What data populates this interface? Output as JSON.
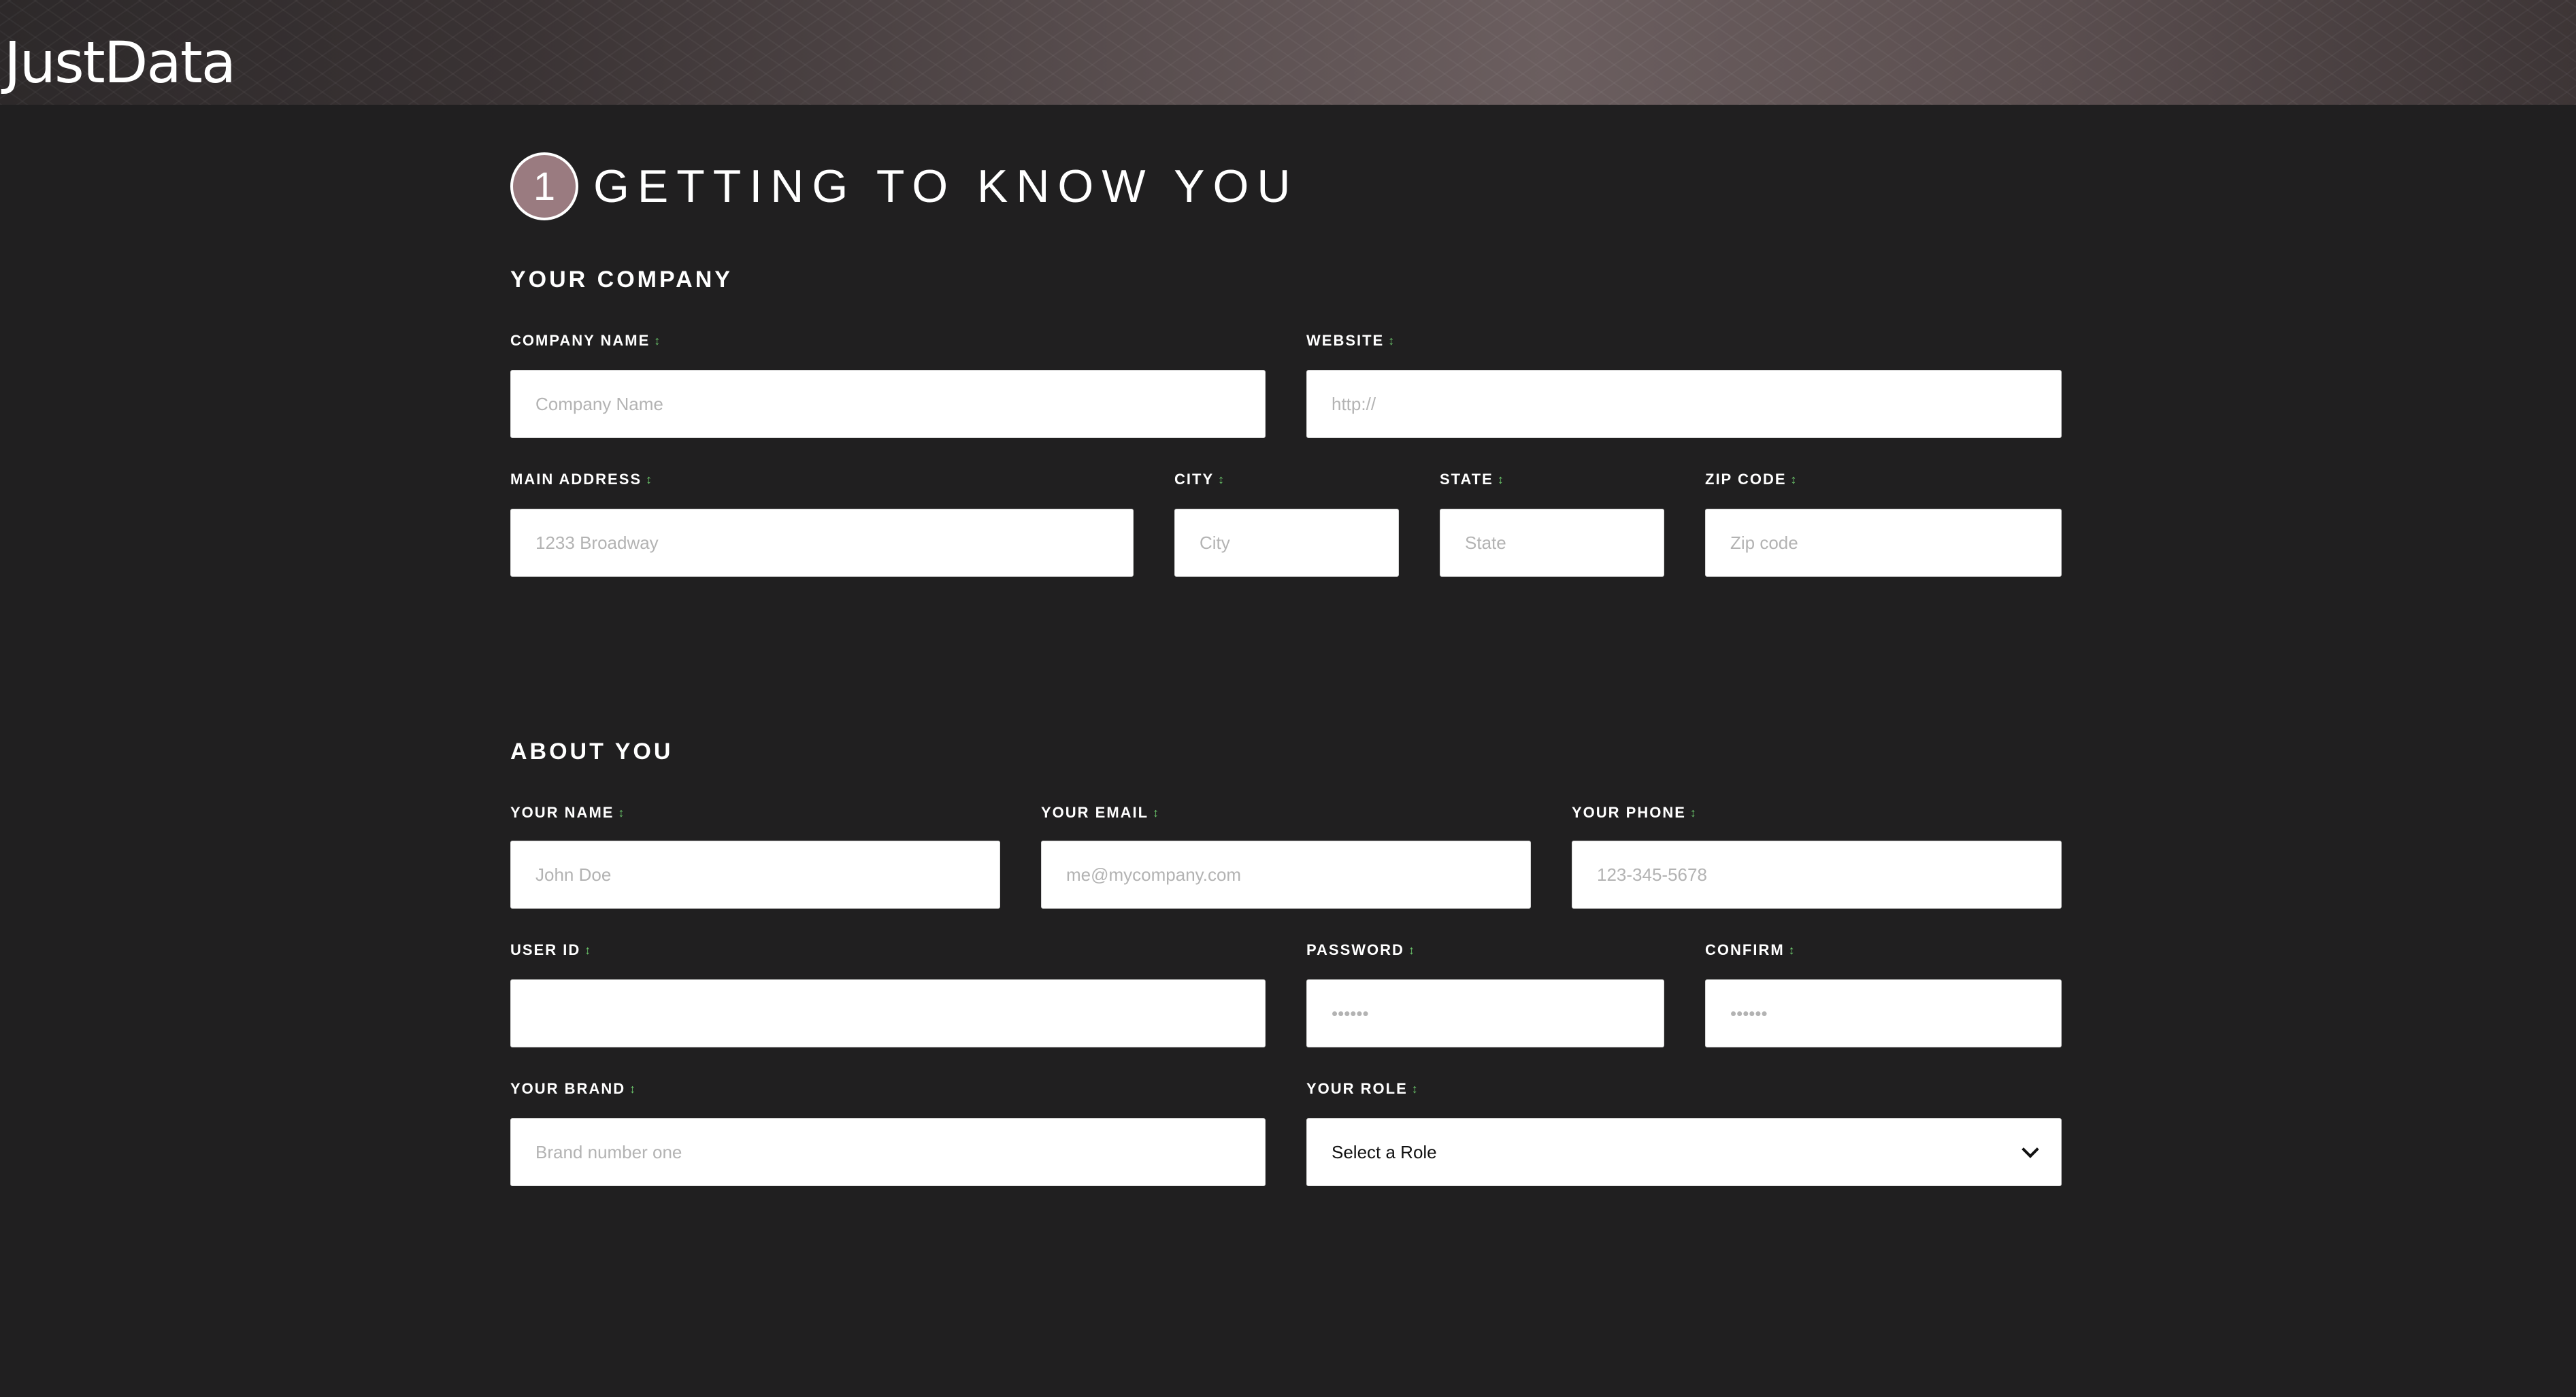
{
  "app": {
    "logo": "JustData"
  },
  "step": {
    "number": "1",
    "title": "GETTING TO KNOW YOU"
  },
  "company": {
    "title": "YOUR COMPANY",
    "company_name": {
      "label": "COMPANY NAME",
      "placeholder": "Company Name",
      "value": ""
    },
    "website": {
      "label": "WEBSITE",
      "placeholder": "http://",
      "value": ""
    },
    "address": {
      "label": "MAIN ADDRESS",
      "placeholder": "1233 Broadway",
      "value": ""
    },
    "city": {
      "label": "CITY",
      "placeholder": "City",
      "value": ""
    },
    "state": {
      "label": "STATE",
      "placeholder": "State",
      "value": ""
    },
    "zip": {
      "label": "ZIP CODE",
      "placeholder": "Zip code",
      "value": ""
    }
  },
  "about": {
    "title": "ABOUT YOU",
    "name": {
      "label": "YOUR NAME",
      "placeholder": "John Doe",
      "value": ""
    },
    "email": {
      "label": "YOUR EMAIL",
      "placeholder": "me@mycompany.com",
      "value": ""
    },
    "phone": {
      "label": "YOUR PHONE",
      "placeholder": "123-345-5678",
      "value": ""
    },
    "user_id": {
      "label": "USER ID",
      "placeholder": "",
      "value": ""
    },
    "password": {
      "label": "PASSWORD",
      "placeholder": "••••••",
      "value": ""
    },
    "confirm": {
      "label": "CONFIRM",
      "placeholder": "••••••",
      "value": ""
    },
    "brand": {
      "label": "YOUR BRAND",
      "placeholder": "Brand number one",
      "value": ""
    },
    "role": {
      "label": "YOUR ROLE",
      "selected": "Select a Role"
    }
  },
  "ui": {
    "required_marker": "↕"
  },
  "colors": {
    "background": "#201f20",
    "badge": "#9a7b80",
    "required_marker": "#6ac46a",
    "input_bg": "#ffffff",
    "placeholder": "#b3b3b3"
  }
}
